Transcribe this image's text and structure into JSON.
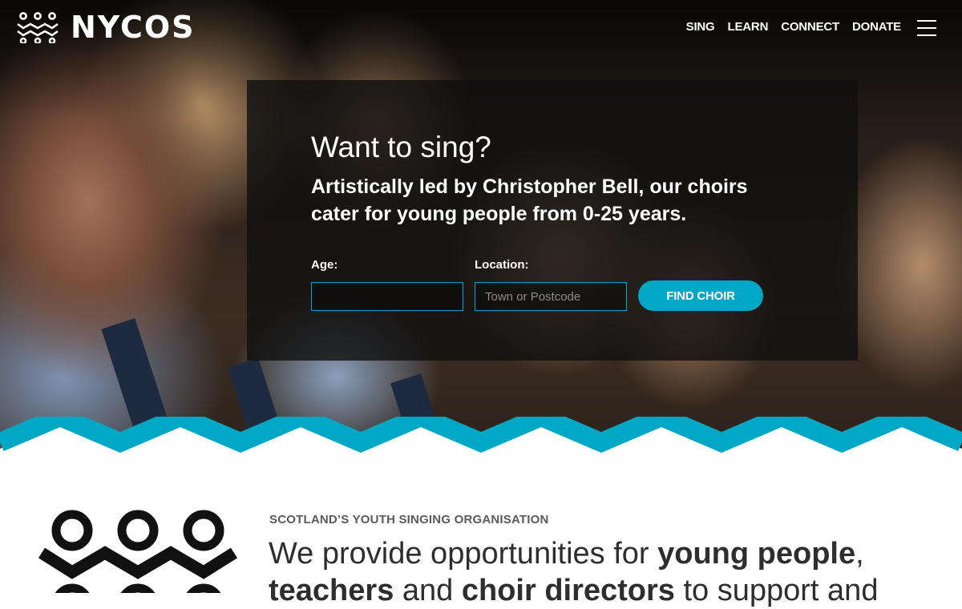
{
  "header": {
    "brand": "NYCOS",
    "nav": [
      "SING",
      "LEARN",
      "CONNECT",
      "DONATE"
    ],
    "menu_icon": "hamburger-menu-icon"
  },
  "hero": {
    "title": "Want to sing?",
    "subtitle": "Artistically led by Christopher Bell, our choirs cater for young people from 0-25 years.",
    "age_label": "Age:",
    "age_value": "",
    "location_label": "Location:",
    "location_placeholder": "Town or Postcode",
    "find_button": "FIND CHOIR"
  },
  "intro": {
    "eyebrow": "SCOTLAND’S YOUTH SINGING ORGANISATION",
    "line1_a": "We provide opportunities for ",
    "line1_b": "young people",
    "line1_c": ",",
    "line2_a": "teachers",
    "line2_b": " and ",
    "line2_c": "choir directors",
    "line2_d": " to support and"
  },
  "colors": {
    "accent": "#00a8c6",
    "text_dark": "#2e2e2e",
    "panel_bg": "rgba(15,15,15,0.80)"
  }
}
